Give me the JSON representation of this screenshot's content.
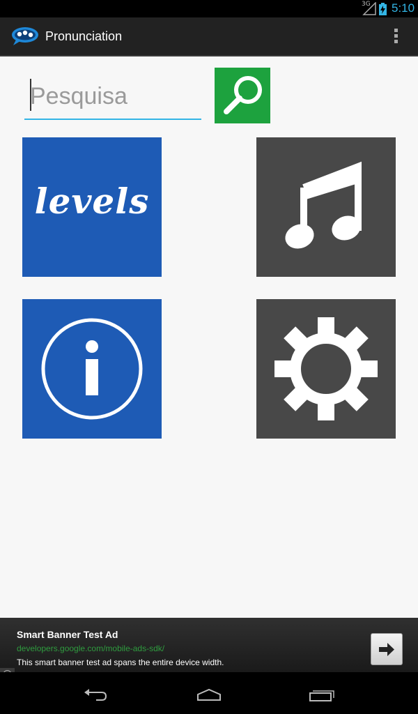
{
  "status_bar": {
    "network_label": "3G",
    "time": "5:10",
    "icons": [
      "signal-icon",
      "battery-charging-icon"
    ]
  },
  "action_bar": {
    "title": "Pronunciation",
    "icons": [
      "app-logo-icon",
      "overflow-menu-icon"
    ]
  },
  "search": {
    "placeholder": "Pesquisa",
    "value": "",
    "button_icon": "magnifier-icon"
  },
  "tiles": [
    {
      "id": "levels",
      "label": "levels",
      "icon": "levels-text",
      "color": "#1e5bb5"
    },
    {
      "id": "music",
      "icon": "music-note-icon",
      "color": "#484848"
    },
    {
      "id": "info",
      "icon": "info-icon",
      "color": "#1e5bb5"
    },
    {
      "id": "settings",
      "icon": "gear-icon",
      "color": "#484848"
    }
  ],
  "ad": {
    "title": "Smart Banner Test Ad",
    "url": "developers.google.com/mobile-ads-sdk/",
    "description": "This smart banner test ad spans the entire device width.",
    "icons": [
      "arrow-right-icon",
      "ad-info-icon"
    ]
  },
  "nav_bar": {
    "icons": [
      "back-icon",
      "home-icon",
      "recent-apps-icon"
    ]
  },
  "colors": {
    "accent": "#33b5e5",
    "search_button": "#1da23e",
    "tile_blue": "#1e5bb5",
    "tile_gray": "#484848",
    "ad_url": "#2f9c3f"
  }
}
